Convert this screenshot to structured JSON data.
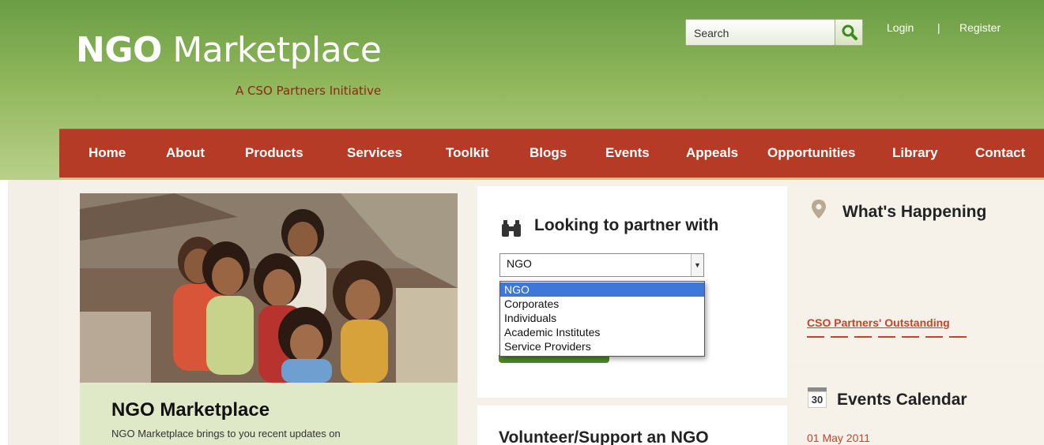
{
  "header": {
    "logo_bold": "NGO",
    "logo_rest": " Marketplace",
    "tagline": "A CSO Partners Initiative",
    "search_placeholder": "Search",
    "login": "Login",
    "separator": "|",
    "register": "Register"
  },
  "nav": [
    "Home",
    "About",
    "Products",
    "Services",
    "Toolkit",
    "Blogs",
    "Events",
    "Appeals",
    "Opportunities",
    "Library",
    "Contact"
  ],
  "hero": {
    "title": "NGO Marketplace",
    "text": "NGO Marketplace brings to you recent updates on"
  },
  "partner": {
    "title": "Looking to partner with",
    "selected": "NGO",
    "options": [
      "NGO",
      "Corporates",
      "Individuals",
      "Academic Institutes",
      "Service Providers"
    ]
  },
  "volunteer": {
    "title": "Volunteer/Support an NGO"
  },
  "happening": {
    "title": "What's Happening",
    "link": "CSO Partners' Outstanding"
  },
  "events": {
    "title": "Events Calendar",
    "icon_day": "30",
    "date": "01 May 2011"
  },
  "colors": {
    "nav": "#b53b26",
    "header_green": "#6a9d45",
    "link": "#c0452a",
    "selected_option": "#3d78d8"
  }
}
